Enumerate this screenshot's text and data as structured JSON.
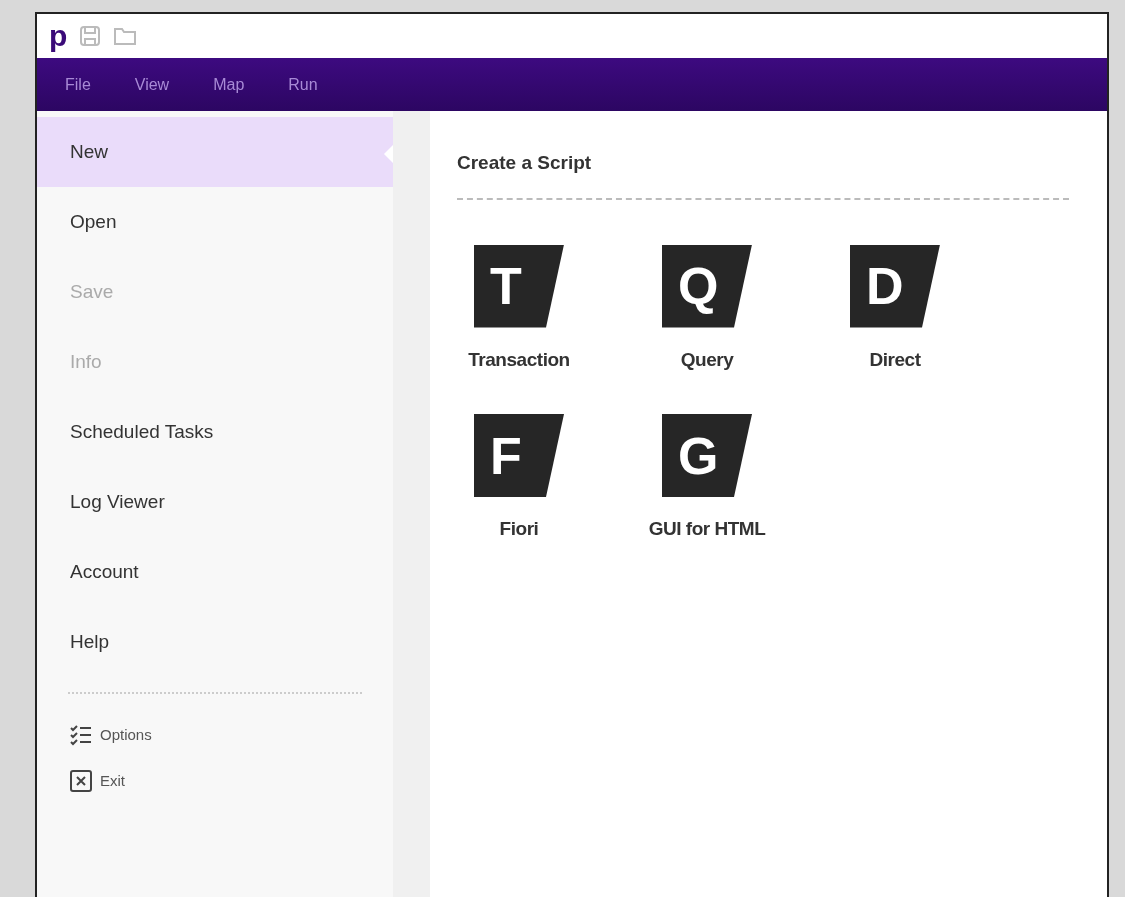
{
  "toolbar": {
    "logo": "p"
  },
  "menu": [
    {
      "label": "File"
    },
    {
      "label": "View"
    },
    {
      "label": "Map"
    },
    {
      "label": "Run"
    }
  ],
  "sidebar": {
    "items": [
      {
        "label": "New",
        "selected": true,
        "disabled": false
      },
      {
        "label": "Open",
        "selected": false,
        "disabled": false
      },
      {
        "label": "Save",
        "selected": false,
        "disabled": true
      },
      {
        "label": "Info",
        "selected": false,
        "disabled": true
      },
      {
        "label": "Scheduled Tasks",
        "selected": false,
        "disabled": false
      },
      {
        "label": "Log Viewer",
        "selected": false,
        "disabled": false
      },
      {
        "label": "Account",
        "selected": false,
        "disabled": false
      },
      {
        "label": "Help",
        "selected": false,
        "disabled": false
      }
    ],
    "actions": [
      {
        "kind": "options",
        "label": "Options"
      },
      {
        "kind": "exit",
        "label": "Exit"
      }
    ]
  },
  "content": {
    "title": "Create a Script",
    "scripts": [
      {
        "letter": "T",
        "label": "Transaction"
      },
      {
        "letter": "Q",
        "label": "Query"
      },
      {
        "letter": "D",
        "label": "Direct"
      },
      {
        "letter": "F",
        "label": "Fiori"
      },
      {
        "letter": "G",
        "label": "GUI for HTML"
      }
    ]
  }
}
